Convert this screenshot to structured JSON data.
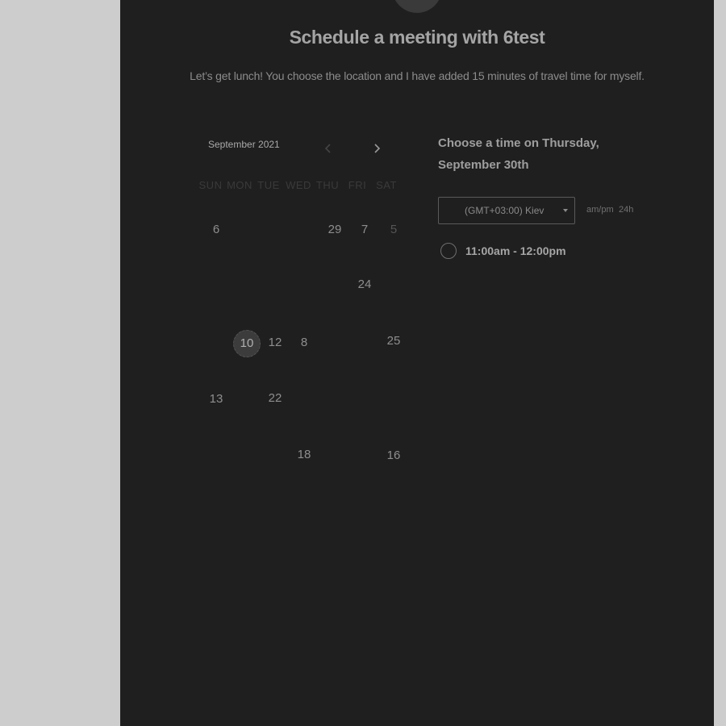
{
  "header": {
    "title": "Schedule a meeting with 6test",
    "description": "Let’s get lunch! You choose the location and I have added 15 minutes of travel time for myself."
  },
  "calendar": {
    "month_label": "September 2021",
    "prev_icon": "chevron-left-icon",
    "next_icon": "chevron-right-icon",
    "weekdays": [
      "SUN",
      "MON",
      "TUE",
      "WED",
      "THU",
      "FRI",
      "SAT"
    ],
    "visible_days": [
      "6",
      "29",
      "7",
      "5",
      "24",
      "10",
      "12",
      "8",
      "25",
      "13",
      "22",
      "18",
      "16"
    ],
    "selected_day": "10"
  },
  "time_picker": {
    "heading": "Choose a time on Thursday, September 30th",
    "timezone": "(GMT+03:00) Kiev",
    "format_ampm": "am/pm",
    "format_24h": "24h",
    "slots": [
      "11:00am - 12:00pm"
    ]
  },
  "colors": {
    "background": "#cdcdcd",
    "panel": "#1f1f1f"
  }
}
